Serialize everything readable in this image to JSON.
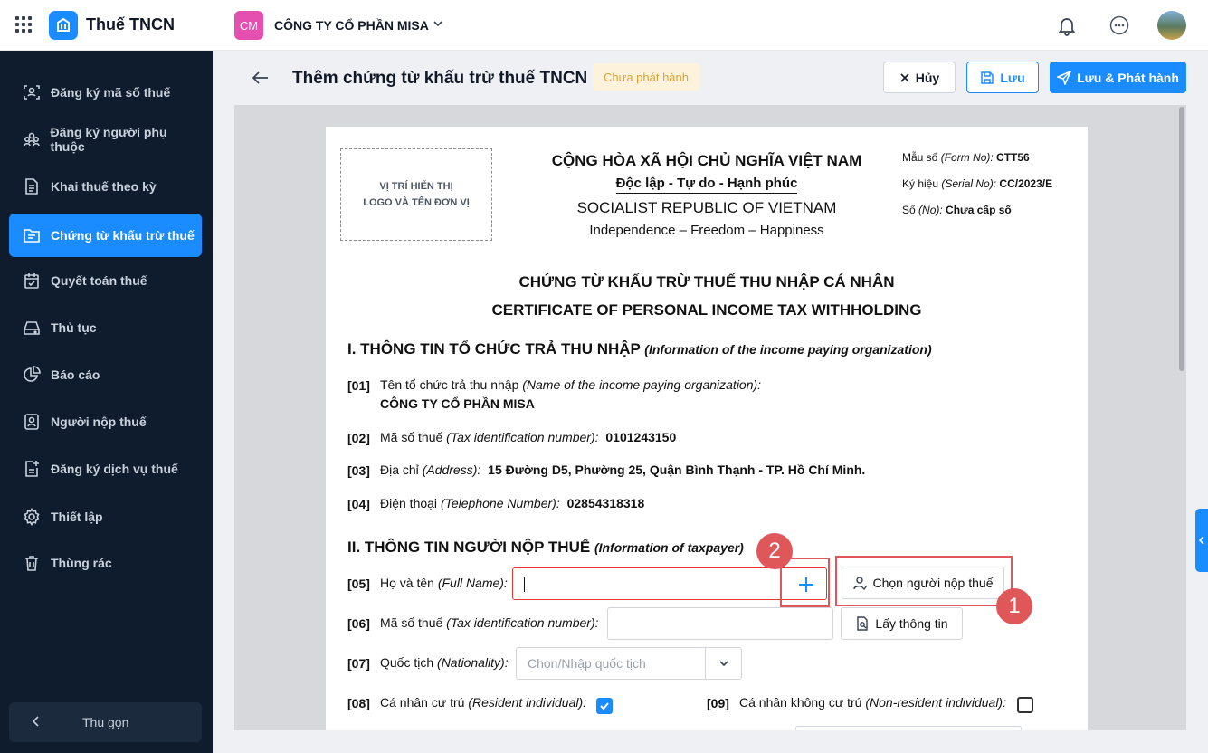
{
  "app": {
    "name": "Thuế TNCN",
    "colors": {
      "accent": "#1a8cff",
      "sidebar_bg": "#0f1c2e",
      "annotation": "#e0575a",
      "badge_text": "#e0a232"
    }
  },
  "org": {
    "initials": "CM",
    "name": "CÔNG TY CỔ PHẦN MISA"
  },
  "sidebar": {
    "items": [
      {
        "label": "Đăng ký mã số thuế",
        "icon": "scan-user-icon"
      },
      {
        "label": "Đăng ký người phụ thuộc",
        "icon": "users-group-icon"
      },
      {
        "label": "Khai thuế theo kỳ",
        "icon": "document-icon"
      },
      {
        "label": "Chứng từ khấu trừ thuế",
        "icon": "folder-doc-icon",
        "active": true
      },
      {
        "label": "Quyết toán thuế",
        "icon": "calendar-check-icon"
      },
      {
        "label": "Thủ tục",
        "icon": "drive-icon"
      },
      {
        "label": "Báo cáo",
        "icon": "pie-chart-icon"
      },
      {
        "label": "Người nộp thuế",
        "icon": "user-card-icon"
      },
      {
        "label": "Đăng ký dịch vụ thuế",
        "icon": "doc-plus-icon"
      },
      {
        "label": "Thiết lập",
        "icon": "gear-icon"
      },
      {
        "label": "Thùng rác",
        "icon": "trash-icon"
      }
    ],
    "collapse_label": "Thu gọn"
  },
  "header": {
    "title": "Thêm chứng từ khấu trừ thuế TNCN",
    "status": "Chưa phát hành",
    "cancel": "Hủy",
    "save": "Lưu",
    "save_publish": "Lưu & Phát hành"
  },
  "document": {
    "logo_placeholder": [
      "VỊ TRÍ HIỂN THỊ",
      "LOGO VÀ TÊN ĐƠN VỊ"
    ],
    "national": {
      "line1": "CỘNG HÒA XÃ HỘI CHỦ NGHĨA VIỆT NAM",
      "line2": "Độc lập - Tự do - Hạnh phúc",
      "line3": "SOCIALIST REPUBLIC OF VIETNAM",
      "line4": "Independence – Freedom – Happiness"
    },
    "meta": {
      "form_label": "Mẫu số",
      "form_en": "(Form No):",
      "form_value": "CTT56",
      "serial_label": "Ký hiệu",
      "serial_en": "(Serial No):",
      "serial_value": "CC/2023/E",
      "number_label": "Số",
      "number_en": "(No):",
      "number_value": "Chưa cấp số"
    },
    "title_vi": "CHỨNG TỪ KHẤU TRỪ THUẾ THU NHẬP CÁ NHÂN",
    "title_en": "CERTIFICATE OF PERSONAL INCOME TAX WITHHOLDING",
    "section1": {
      "title": "I. THÔNG TIN TỔ CHỨC TRẢ THU NHẬP",
      "title_en": "(Information of the income paying organization)"
    },
    "f01": {
      "num": "[01]",
      "label": "Tên tổ chức trả thu nhập",
      "label_en": "(Name of the income paying organization):",
      "value": "CÔNG TY CỔ PHẦN MISA"
    },
    "f02": {
      "num": "[02]",
      "label": "Mã số thuế",
      "label_en": "(Tax identification number):",
      "value": "0101243150"
    },
    "f03": {
      "num": "[03]",
      "label": "Địa chỉ",
      "label_en": "(Address):",
      "value": "15 Đường D5, Phường 25, Quận Bình Thạnh - TP. Hồ Chí Minh."
    },
    "f04": {
      "num": "[04]",
      "label": "Điện thoại",
      "label_en": "(Telephone Number):",
      "value": "02854318318"
    },
    "section2": {
      "title": "II. THÔNG TIN NGƯỜI NỘP THUẾ",
      "title_en": "(Information of taxpayer)"
    },
    "f05": {
      "num": "[05]",
      "label": "Họ và tên",
      "label_en": "(Full Name):",
      "value": "",
      "select_button": "Chọn người nộp thuế"
    },
    "f06": {
      "num": "[06]",
      "label": "Mã số thuế",
      "label_en": "(Tax identification number):",
      "value": "",
      "fetch_button": "Lấy thông tin"
    },
    "f07": {
      "num": "[07]",
      "label": "Quốc tịch",
      "label_en": "(Nationality):",
      "placeholder": "Chọn/Nhập quốc tịch"
    },
    "f08": {
      "num": "[08]",
      "label": "Cá nhân cư trú",
      "label_en": "(Resident individual):",
      "checked": true
    },
    "f09": {
      "num": "[09]",
      "label": "Cá nhân không cư trú",
      "label_en": "(Non-resident individual):",
      "checked": false
    }
  },
  "annotations": {
    "step1": "1",
    "step2": "2"
  }
}
